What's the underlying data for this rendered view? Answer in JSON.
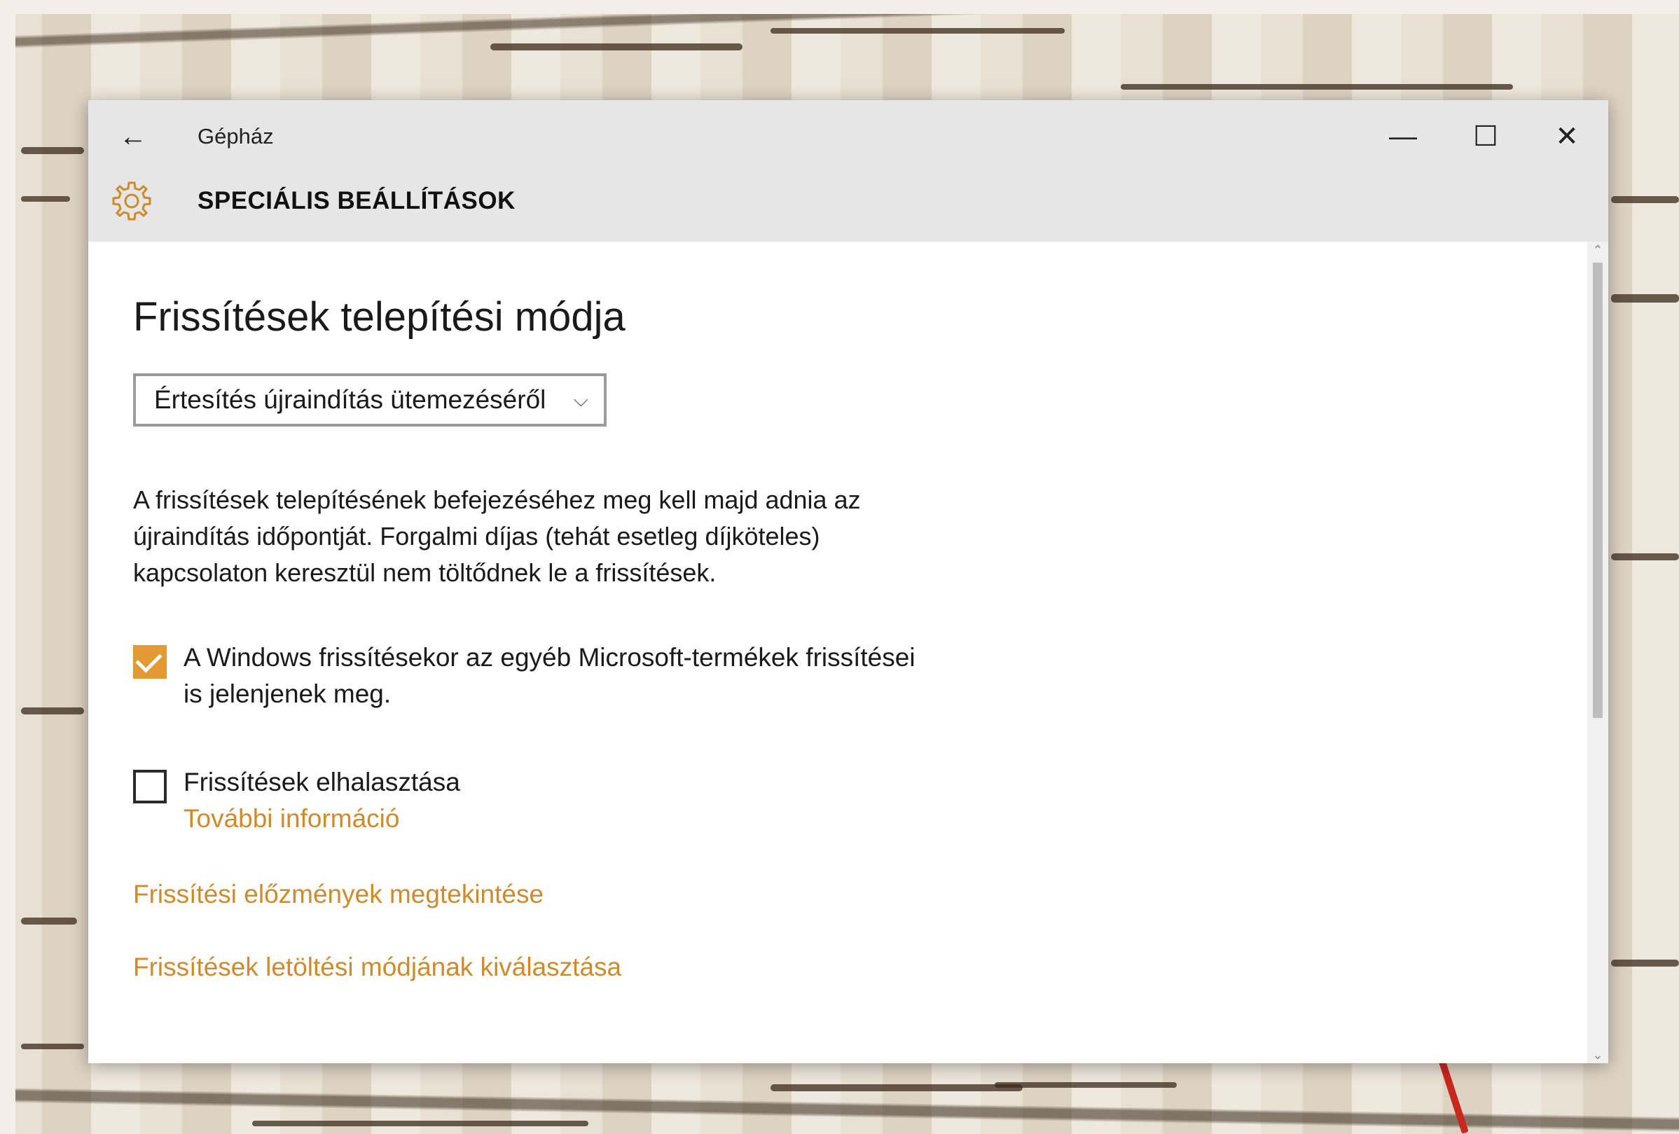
{
  "window": {
    "app_title": "Gépház",
    "back_icon": "arrow-left-icon",
    "controls": {
      "minimize": "—",
      "maximize": "☐",
      "close": "✕"
    }
  },
  "header": {
    "icon": "gear-icon",
    "title": "SPECIÁLIS BEÁLLÍTÁSOK"
  },
  "main": {
    "section_title": "Frissítések telepítési módja",
    "dropdown": {
      "value": "Értesítés újraindítás ütemezéséről",
      "chevron": "⌵"
    },
    "description": "A frissítések telepítésének befejezéséhez meg kell majd adnia az újraindítás időpontját. Forgalmi díjas (tehát esetleg díjköteles) kapcsolaton keresztül nem töltődnek le a frissítések.",
    "checkbox_other_products": {
      "label": "A Windows frissítésekor az egyéb Microsoft-termékek frissítései is jelenjenek meg.",
      "checked": true
    },
    "checkbox_defer": {
      "label": "Frissítések elhalasztása",
      "checked": false,
      "more_info_link": "További információ"
    },
    "links": {
      "history": "Frissítési előzmények megtekintése",
      "download_mode": "Frissítések letöltési módjának kiválasztása"
    }
  },
  "colors": {
    "accent": "#e39a33",
    "link": "#d08a2a",
    "titlebar": "#e6e6e6"
  }
}
